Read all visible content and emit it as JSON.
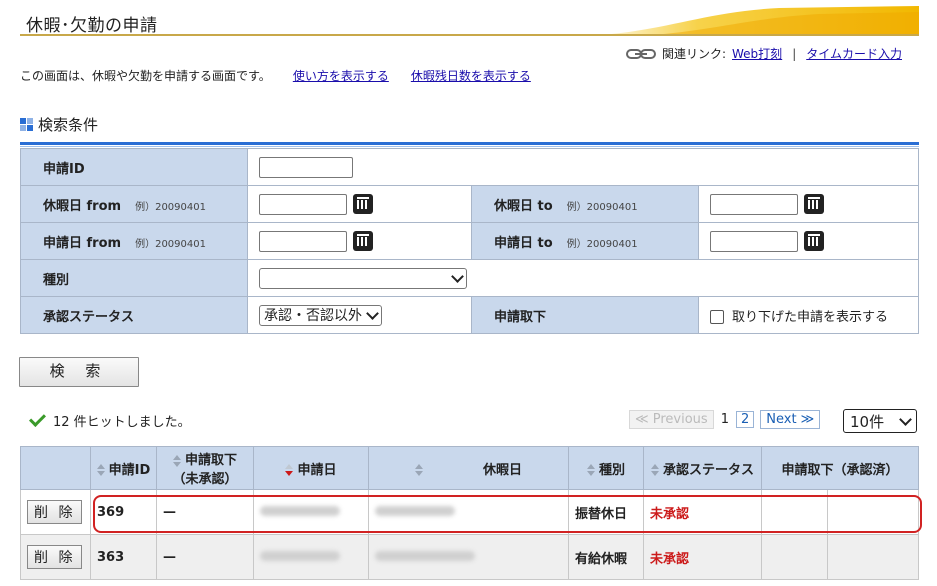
{
  "page": {
    "title": "休暇･欠勤の申請",
    "related_prefix": "関連リンク:",
    "related_links": [
      "Web打刻",
      "タイムカード入力"
    ],
    "intro_text": "この画面は、休暇や欠勤を申請する画面です。",
    "intro_links": [
      "使い方を表示する",
      "休暇残日数を表示する"
    ]
  },
  "search": {
    "heading": "検索条件",
    "request_id_label": "申請ID",
    "leave_from_label": "休暇日 from",
    "leave_to_label": "休暇日 to",
    "apply_from_label": "申請日 from",
    "apply_to_label": "申請日 to",
    "example_hint": "例）20090401",
    "type_label": "種別",
    "type_value": "",
    "approval_label": "承認ステータス",
    "approval_value": "承認・否認以外",
    "withdraw_label": "申請取下",
    "withdraw_checkbox_label": "取り下げた申請を表示する",
    "search_button": "検 索"
  },
  "results": {
    "hit_count_text": "12 件ヒットしました。",
    "pager": {
      "prev": "≪ Previous",
      "current": "1",
      "page2": "2",
      "next": "Next ≫"
    },
    "per_page": "10件",
    "columns": [
      "申請ID",
      "申請取下（未承認）",
      "申請日",
      "休暇日",
      "種別",
      "承認ステータス",
      "申請取下（承認済）"
    ],
    "rows": [
      {
        "action": "削 除",
        "id": "369",
        "withdraw_pending": "—",
        "type": "振替休日",
        "status": "未承認"
      },
      {
        "action": "削 除",
        "id": "363",
        "withdraw_pending": "—",
        "type": "有給休暇",
        "status": "未承認"
      }
    ]
  },
  "colors": {
    "accent_gold": "#f5c518",
    "header_blue": "#c9d8ec",
    "rule_blue": "#2a6ed4",
    "status_red": "#cc1a1a"
  }
}
